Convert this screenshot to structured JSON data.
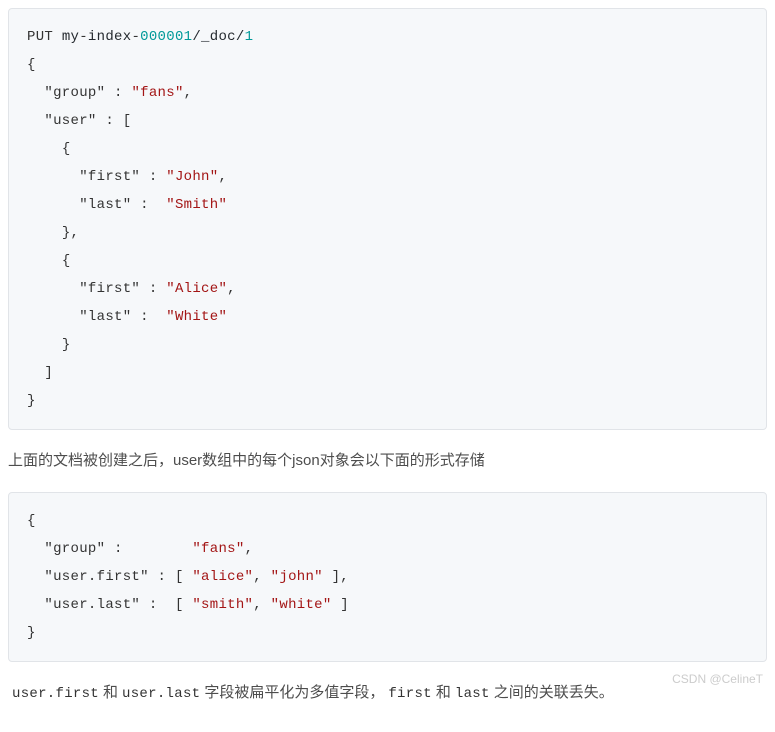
{
  "code1": {
    "method": "PUT",
    "index_prefix": "my",
    "index_mid": "index",
    "index_num": "000001",
    "path1": "/_doc/",
    "path_id": "1",
    "group_key": "\"group\"",
    "group_val": "\"fans\"",
    "user_key": "\"user\"",
    "first_key": "\"first\"",
    "last_key": "\"last\"",
    "john": "\"John\"",
    "smith": "\"Smith\"",
    "alice": "\"Alice\"",
    "white": "\"White\""
  },
  "para1": "上面的文档被创建之后，user数组中的每个json对象会以下面的形式存储",
  "code2": {
    "group_key": "\"group\"",
    "group_val": "\"fans\"",
    "uf_key": "\"user.first\"",
    "ul_key": "\"user.last\"",
    "alice": "\"alice\"",
    "john": "\"john\"",
    "smith": "\"smith\"",
    "white": "\"white\""
  },
  "para2": {
    "c1": "user.first",
    "t1": "和",
    "c2": "user.last",
    "t2": "字段被扁平化为多值字段，",
    "c3": "first",
    "t3": "和",
    "c4": "last",
    "t4": "之间的关联丢失。"
  },
  "watermark": "CSDN @CelineT"
}
